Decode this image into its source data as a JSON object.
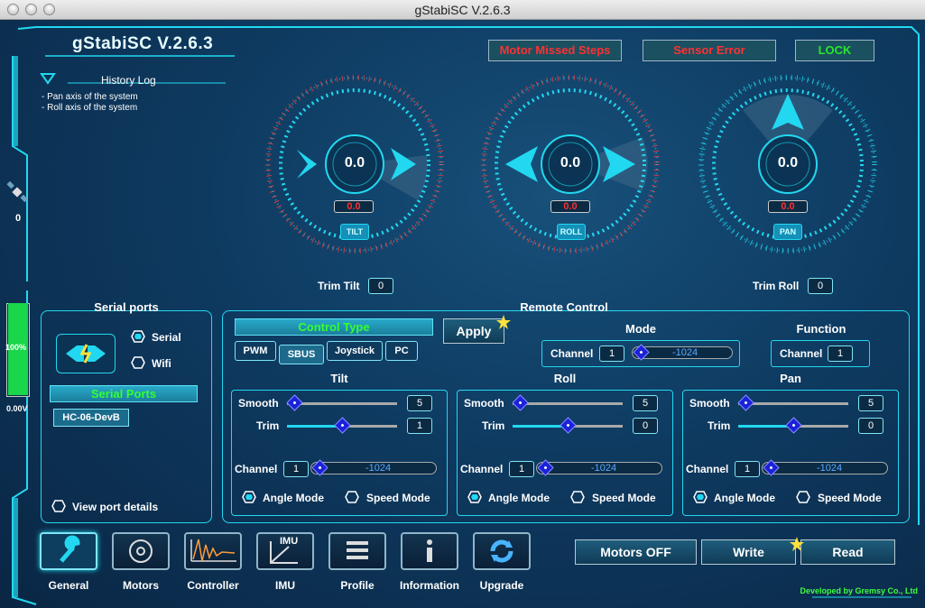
{
  "window": {
    "title": "gStabiSC V.2.6.3"
  },
  "app": {
    "title": "gStabiSC V.2.6.3"
  },
  "alerts": {
    "motor": "Motor Missed Steps",
    "sensor": "Sensor Error",
    "lock": "LOCK"
  },
  "history": {
    "title": "History Log",
    "lines": [
      "- Pan axis of the system",
      "- Roll axis of the system"
    ]
  },
  "side": {
    "satellite_count": "0",
    "battery_percent": "100%",
    "battery_voltage": "0.00V",
    "battery_level": 1.0
  },
  "dials": {
    "tilt": {
      "value": "0.0",
      "sub_value": "0.0",
      "badge": "TILT"
    },
    "roll": {
      "value": "0.0",
      "sub_value": "0.0",
      "badge": "ROLL"
    },
    "pan": {
      "value": "0.0",
      "sub_value": "0.0",
      "badge": "PAN"
    }
  },
  "trim": {
    "tilt_label": "Trim Tilt",
    "tilt_value": "0",
    "roll_label": "Trim Roll",
    "roll_value": "0"
  },
  "serial": {
    "title": "Serial ports",
    "serial_label": "Serial",
    "wifi_label": "Wifi",
    "ports_header": "Serial Ports",
    "port_item": "HC-06-DevB",
    "view_details": "View port details"
  },
  "remote": {
    "title": "Remote Control",
    "control_type": "Control Type",
    "types": [
      "PWM",
      "SBUS",
      "Joystick",
      "PC"
    ],
    "selected_type": "SBUS",
    "apply": "Apply",
    "mode": {
      "title": "Mode",
      "channel_label": "Channel",
      "channel": "1",
      "value": "-1024"
    },
    "function": {
      "title": "Function",
      "channel_label": "Channel",
      "channel": "1"
    },
    "axes": [
      {
        "title": "Tilt",
        "smooth_label": "Smooth",
        "smooth": "5",
        "trim_label": "Trim",
        "trim": "1",
        "channel_label": "Channel",
        "channel": "1",
        "channel_value": "-1024",
        "angle": "Angle Mode",
        "speed": "Speed Mode"
      },
      {
        "title": "Roll",
        "smooth_label": "Smooth",
        "smooth": "5",
        "trim_label": "Trim",
        "trim": "0",
        "channel_label": "Channel",
        "channel": "1",
        "channel_value": "-1024",
        "angle": "Angle Mode",
        "speed": "Speed Mode"
      },
      {
        "title": "Pan",
        "smooth_label": "Smooth",
        "smooth": "5",
        "trim_label": "Trim",
        "trim": "0",
        "channel_label": "Channel",
        "channel": "1",
        "channel_value": "-1024",
        "angle": "Angle Mode",
        "speed": "Speed Mode"
      }
    ]
  },
  "nav": [
    "General",
    "Motors",
    "Controller",
    "IMU",
    "Profile",
    "Information",
    "Upgrade"
  ],
  "nav_imu_icon_text": "IMU",
  "actions": {
    "motors_off": "Motors OFF",
    "write": "Write",
    "read": "Read"
  },
  "footer": "Developed by Gremsy Co., Ltd",
  "colors": {
    "accent": "#22d8f0",
    "alert_red": "#ff3030",
    "ok_green": "#27e827",
    "knob": "#1a23d9"
  }
}
